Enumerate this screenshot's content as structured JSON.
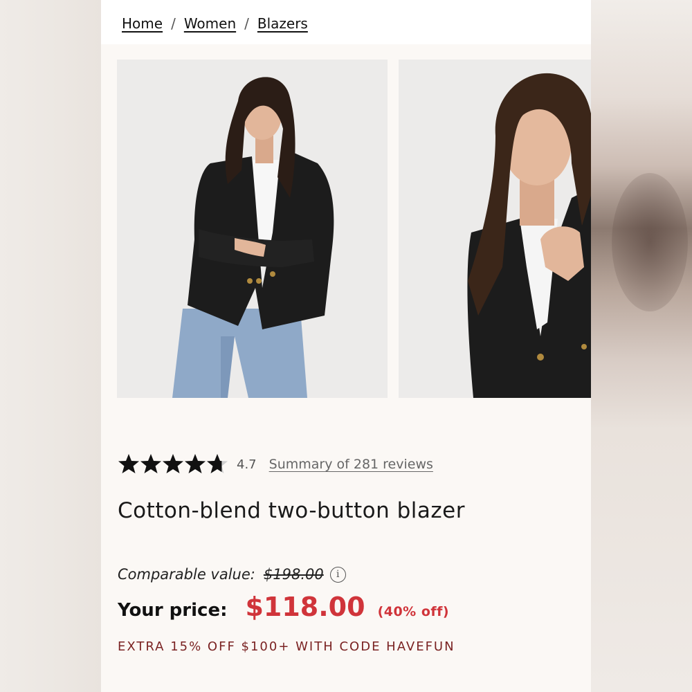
{
  "breadcrumb": {
    "items": [
      {
        "label": "Home"
      },
      {
        "label": "Women"
      },
      {
        "label": "Blazers"
      }
    ],
    "separator": "/"
  },
  "gallery": {
    "images": [
      {
        "alt": "Model wearing black blazer with jeans, arms crossed"
      },
      {
        "alt": "Close-up of model in black blazer, hand on lapel"
      }
    ]
  },
  "rating": {
    "value": "4.7",
    "stars_filled_fraction": 0.94,
    "stars_total": 5,
    "reviews_link": "Summary of 281 reviews"
  },
  "product": {
    "title": "Cotton-blend two-button blazer"
  },
  "pricing": {
    "comparable_label": "Comparable value:",
    "comparable_price": "$198.00",
    "your_price_label": "Your price:",
    "price": "$118.00",
    "discount": "(40% off)",
    "promo": "EXTRA 15% OFF $100+ WITH CODE HAVEFUN"
  },
  "colors": {
    "sale_red": "#d0343a",
    "promo_maroon": "#7a2222",
    "text": "#111111"
  }
}
